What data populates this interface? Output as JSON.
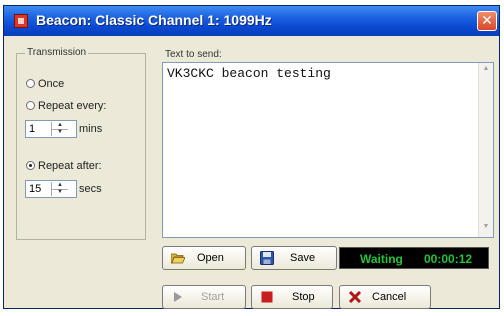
{
  "window": {
    "title": "Beacon: Classic Channel 1: 1099Hz",
    "close_glyph": "✕"
  },
  "transmission": {
    "legend": "Transmission",
    "once_label": "Once",
    "repeat_every_label": "Repeat every:",
    "repeat_every_value": "1",
    "repeat_every_unit": "mins",
    "repeat_after_label": "Repeat after:",
    "repeat_after_value": "15",
    "repeat_after_unit": "secs",
    "selected": "repeat_after"
  },
  "message": {
    "label": "Text to send:",
    "text": "VK3CKC beacon testing"
  },
  "buttons": {
    "open": "Open",
    "save": "Save",
    "start": "Start",
    "stop": "Stop",
    "cancel": "Cancel"
  },
  "status": {
    "state": "Waiting",
    "time": "00:00:12"
  },
  "colors": {
    "status_text": "#23c23a",
    "titlebar": "#0a49d1",
    "stop_icon": "#c81e1e",
    "cancel_icon": "#b01818"
  }
}
